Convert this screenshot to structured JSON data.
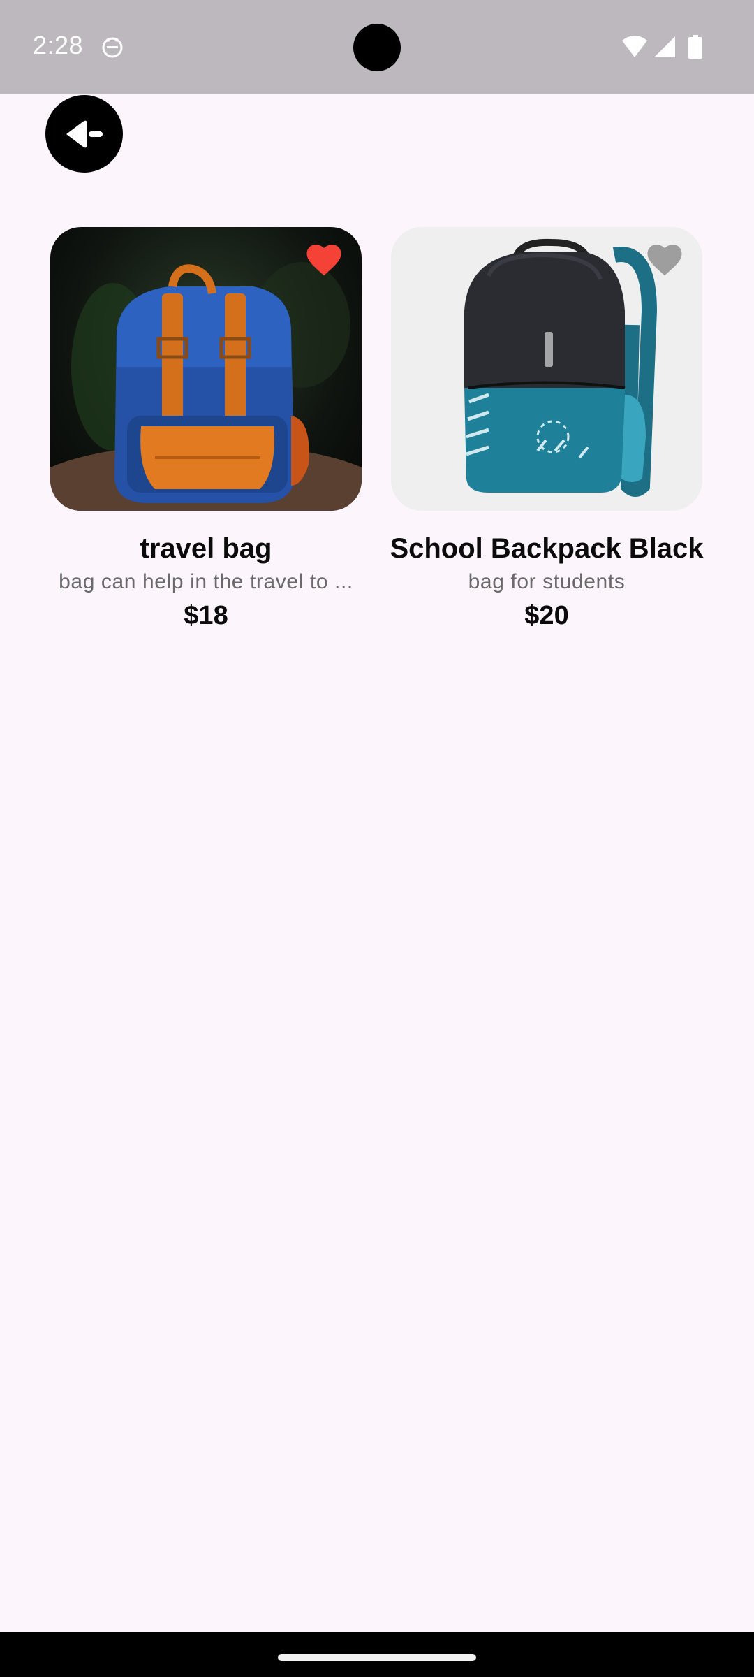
{
  "status_bar": {
    "time": "2:28",
    "icons": [
      "cat-app-icon",
      "wifi-icon",
      "signal-icon",
      "battery-icon"
    ]
  },
  "back_button": {
    "icon": "arrow-back-icon"
  },
  "products": [
    {
      "title": "travel bag",
      "description": "bag can help in the travel to ...",
      "price": "$18",
      "favorite": true,
      "image_icon": "blue-backpack-photo"
    },
    {
      "title": "School Backpack Black",
      "description": "bag for students",
      "price": "$20",
      "favorite": false,
      "image_icon": "teal-backpack-photo"
    }
  ],
  "colors": {
    "background": "#fcf5fc",
    "status_bar": "#bdb8bd",
    "favorite_active": "#f44336",
    "favorite_inactive": "#9e9e9e",
    "text_primary": "#0b0b0b",
    "text_secondary": "#6a6a6a"
  }
}
